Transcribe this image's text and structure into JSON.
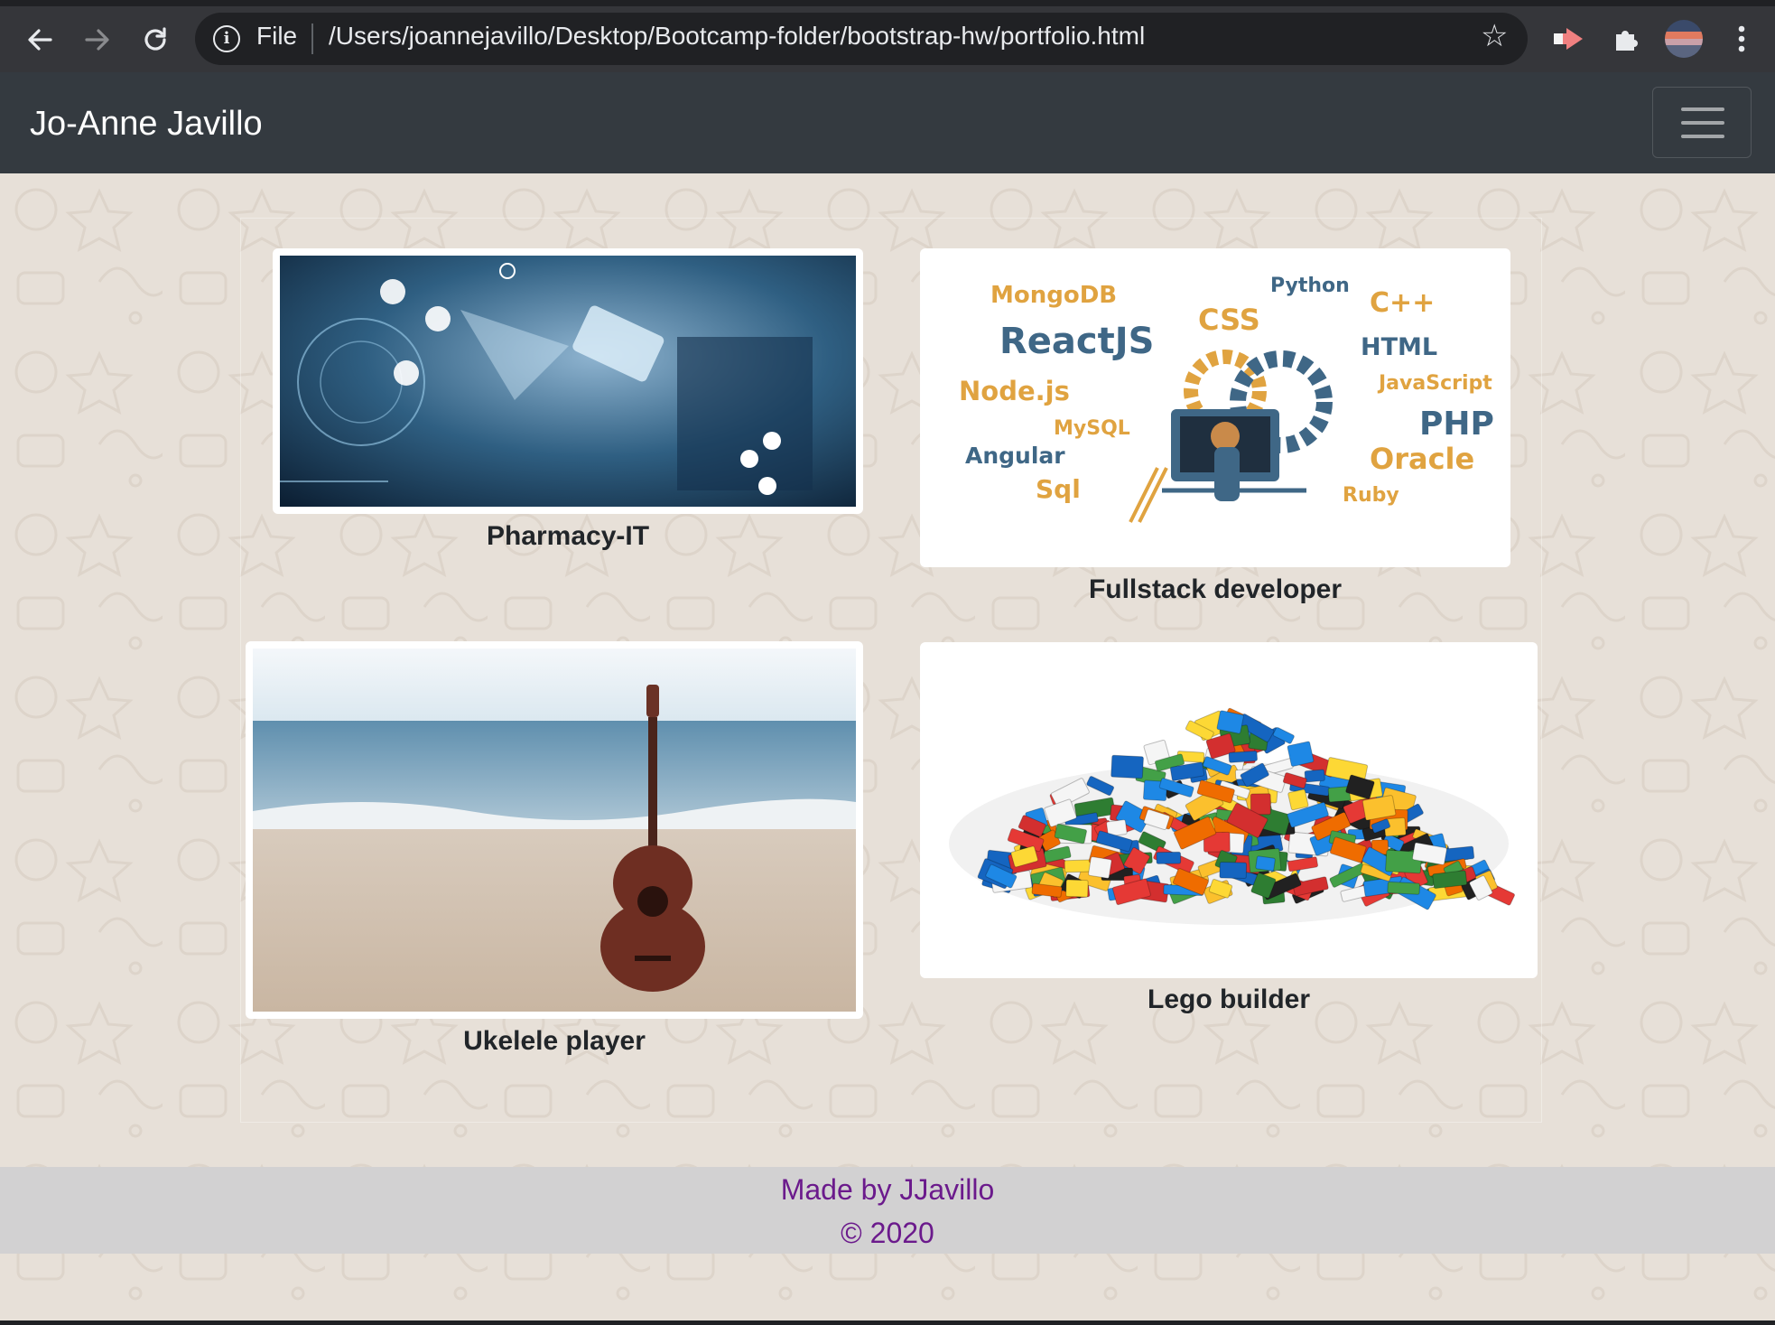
{
  "browser": {
    "scheme_label": "File",
    "url": "/Users/joannejavillo/Desktop/Bootcamp-folder/bootstrap-hw/portfolio.html"
  },
  "navbar": {
    "brand": "Jo-Anne Javillo"
  },
  "portfolio": {
    "items": [
      {
        "caption": "Pharmacy-IT"
      },
      {
        "caption": "Fullstack developer",
        "image_words": [
          "Python",
          "MongoDB",
          "C++",
          "CSS",
          "ReactJS",
          "HTML",
          "JavaScript",
          "Node.js",
          "MySQL",
          "PHP",
          "Angular",
          "Oracle",
          "Sql",
          "Ruby"
        ]
      },
      {
        "caption": "Ukelele player"
      },
      {
        "caption": "Lego builder"
      }
    ]
  },
  "footer": {
    "made_by": "Made by JJavillo",
    "copyright": "© 2020"
  },
  "colors": {
    "navbar": "#343a40",
    "page_bg": "#e7e0d8",
    "footer_bg": "#d2d1d2",
    "footer_text": "#6b1a8c"
  }
}
